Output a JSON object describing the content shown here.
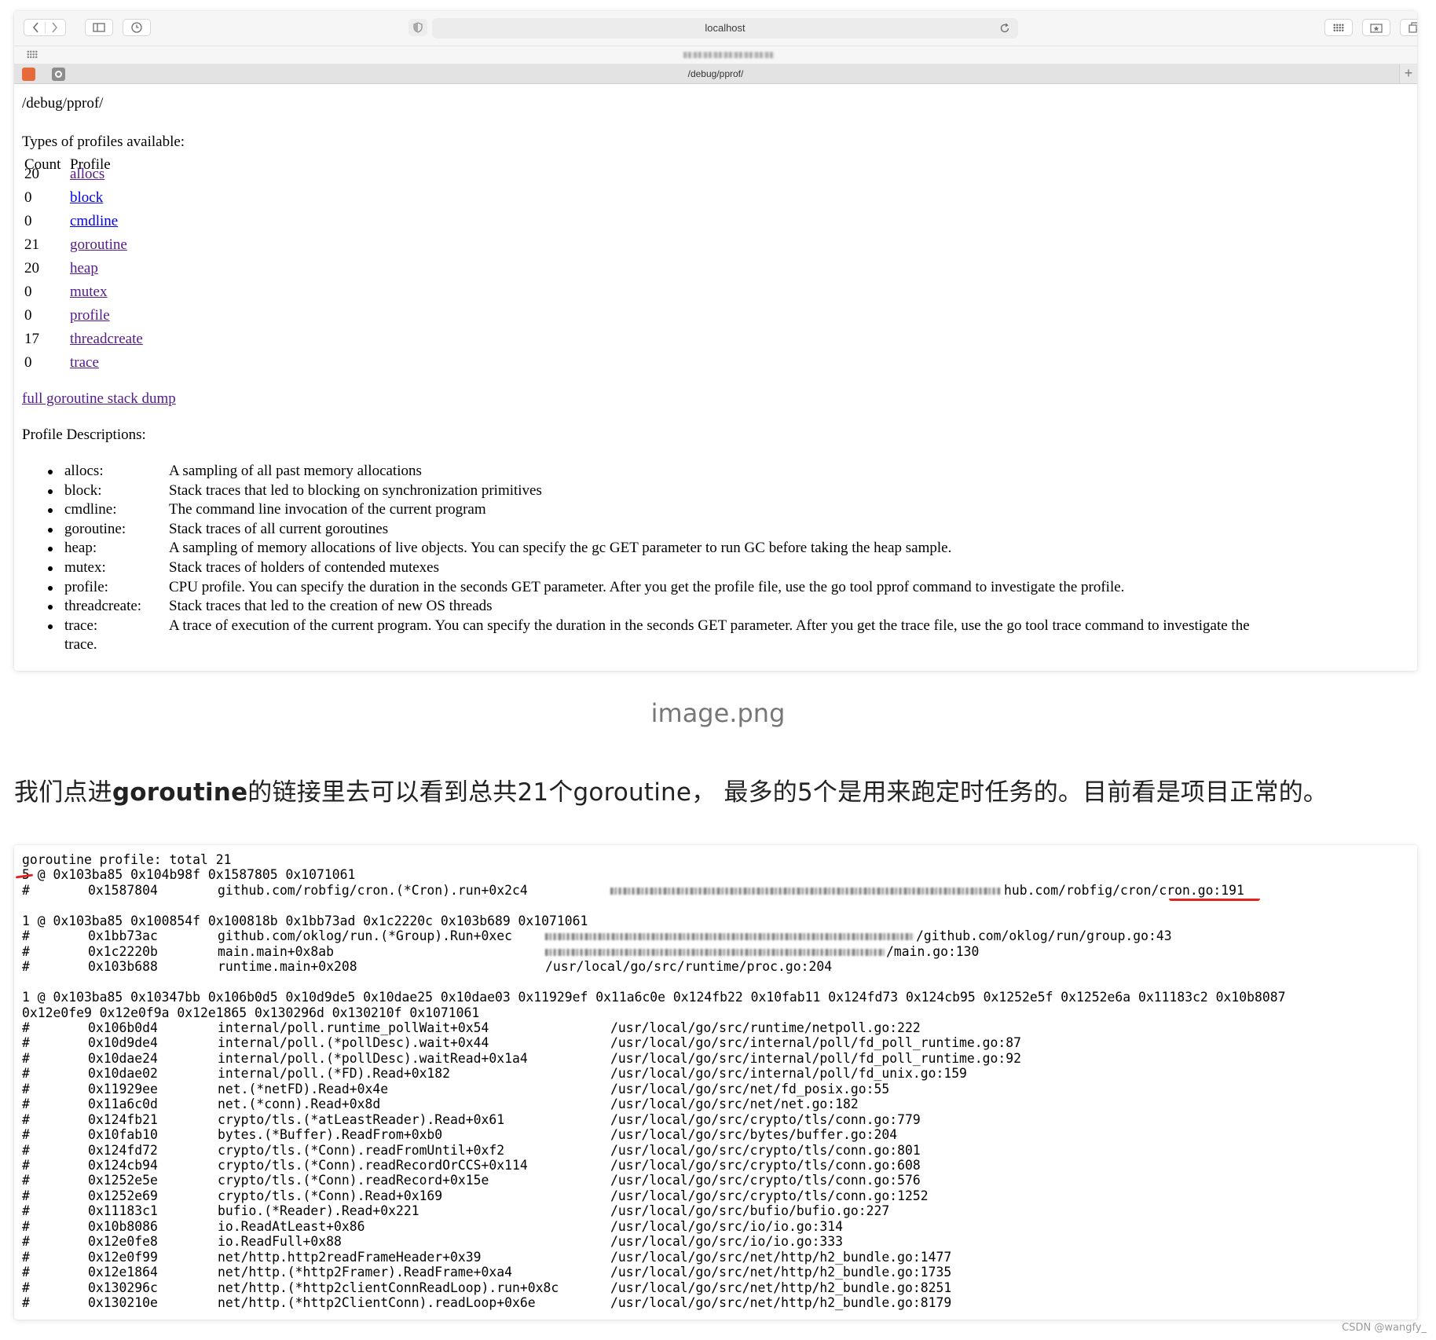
{
  "browser": {
    "address": "localhost",
    "tab_title": "/debug/pprof/",
    "tab_plus": "+"
  },
  "page": {
    "title": "/debug/pprof/",
    "types_heading": "Types of profiles available:",
    "col_count": "Count",
    "col_profile": "Profile",
    "profiles": [
      {
        "count": "20",
        "name": "allocs"
      },
      {
        "count": "0",
        "name": "block"
      },
      {
        "count": "0",
        "name": "cmdline"
      },
      {
        "count": "21",
        "name": "goroutine"
      },
      {
        "count": "20",
        "name": "heap"
      },
      {
        "count": "0",
        "name": "mutex"
      },
      {
        "count": "0",
        "name": "profile"
      },
      {
        "count": "17",
        "name": "threadcreate"
      },
      {
        "count": "0",
        "name": "trace"
      }
    ],
    "full_dump_link": "full goroutine stack dump",
    "descriptions_heading": "Profile Descriptions:",
    "descriptions": [
      {
        "term": "allocs:",
        "text": "A sampling of all past memory allocations"
      },
      {
        "term": "block:",
        "text": "Stack traces that led to blocking on synchronization primitives"
      },
      {
        "term": "cmdline:",
        "text": "The command line invocation of the current program"
      },
      {
        "term": "goroutine:",
        "text": "Stack traces of all current goroutines"
      },
      {
        "term": "heap:",
        "text": "A sampling of memory allocations of live objects. You can specify the gc GET parameter to run GC before taking the heap sample."
      },
      {
        "term": "mutex:",
        "text": "Stack traces of holders of contended mutexes"
      },
      {
        "term": "profile:",
        "text": "CPU profile. You can specify the duration in the seconds GET parameter. After you get the profile file, use the go tool pprof command to investigate the profile."
      },
      {
        "term": "threadcreate:",
        "text": "Stack traces that led to the creation of new OS threads"
      },
      {
        "term": "trace:",
        "text": "A trace of execution of the current program. You can specify the duration in the seconds GET parameter. After you get the trace file, use the go tool trace command to investigate the",
        "wrap": "trace."
      }
    ]
  },
  "caption": "image.png",
  "paragraph": {
    "before": "我们点进",
    "bold": "goroutine",
    "after": "的链接里去可以看到总共21个goroutine，  最多的5个是用来跑定时任务的。目前看是项目正常的。"
  },
  "dump": {
    "header": "goroutine profile: total 21",
    "block1": {
      "head": "5 @ 0x103ba85 0x104b98f 0x1587805 0x1071061",
      "frames": [
        {
          "addr": "0x1587804",
          "func": "github.com/robfig/cron.(*Cron).run+0x2c4",
          "file": "hub.com/robfig/cron/cron.go:191"
        }
      ]
    },
    "block2": {
      "head": "1 @ 0x103ba85 0x100854f 0x100818b 0x1bb73ad 0x1c2220c 0x103b689 0x1071061",
      "frames": [
        {
          "addr": "0x1bb73ac",
          "func": "github.com/oklog/run.(*Group).Run+0xec",
          "file": "/github.com/oklog/run/group.go:43"
        },
        {
          "addr": "0x1c2220b",
          "func": "main.main+0x8ab",
          "file": "/main.go:130"
        },
        {
          "addr": "0x103b688",
          "func": "runtime.main+0x208",
          "file": "/usr/local/go/src/runtime/proc.go:204"
        }
      ]
    },
    "block3": {
      "head": "1 @ 0x103ba85 0x10347bb 0x106b0d5 0x10d9de5 0x10dae25 0x10dae03 0x11929ef 0x11a6c0e 0x124fb22 0x10fab11 0x124fd73 0x124cb95 0x1252e5f 0x1252e6a 0x11183c2 0x10b8087",
      "head2": "0x12e0fe9 0x12e0f9a 0x12e1865 0x130296d 0x130210f 0x1071061",
      "frames": [
        {
          "addr": "0x106b0d4",
          "func": "internal/poll.runtime_pollWait+0x54",
          "file": "/usr/local/go/src/runtime/netpoll.go:222"
        },
        {
          "addr": "0x10d9de4",
          "func": "internal/poll.(*pollDesc).wait+0x44",
          "file": "/usr/local/go/src/internal/poll/fd_poll_runtime.go:87"
        },
        {
          "addr": "0x10dae24",
          "func": "internal/poll.(*pollDesc).waitRead+0x1a4",
          "file": "/usr/local/go/src/internal/poll/fd_poll_runtime.go:92"
        },
        {
          "addr": "0x10dae02",
          "func": "internal/poll.(*FD).Read+0x182",
          "file": "/usr/local/go/src/internal/poll/fd_unix.go:159"
        },
        {
          "addr": "0x11929ee",
          "func": "net.(*netFD).Read+0x4e",
          "file": "/usr/local/go/src/net/fd_posix.go:55"
        },
        {
          "addr": "0x11a6c0d",
          "func": "net.(*conn).Read+0x8d",
          "file": "/usr/local/go/src/net/net.go:182"
        },
        {
          "addr": "0x124fb21",
          "func": "crypto/tls.(*atLeastReader).Read+0x61",
          "file": "/usr/local/go/src/crypto/tls/conn.go:779"
        },
        {
          "addr": "0x10fab10",
          "func": "bytes.(*Buffer).ReadFrom+0xb0",
          "file": "/usr/local/go/src/bytes/buffer.go:204"
        },
        {
          "addr": "0x124fd72",
          "func": "crypto/tls.(*Conn).readFromUntil+0xf2",
          "file": "/usr/local/go/src/crypto/tls/conn.go:801"
        },
        {
          "addr": "0x124cb94",
          "func": "crypto/tls.(*Conn).readRecordOrCCS+0x114",
          "file": "/usr/local/go/src/crypto/tls/conn.go:608"
        },
        {
          "addr": "0x1252e5e",
          "func": "crypto/tls.(*Conn).readRecord+0x15e",
          "file": "/usr/local/go/src/crypto/tls/conn.go:576"
        },
        {
          "addr": "0x1252e69",
          "func": "crypto/tls.(*Conn).Read+0x169",
          "file": "/usr/local/go/src/crypto/tls/conn.go:1252"
        },
        {
          "addr": "0x11183c1",
          "func": "bufio.(*Reader).Read+0x221",
          "file": "/usr/local/go/src/bufio/bufio.go:227"
        },
        {
          "addr": "0x10b8086",
          "func": "io.ReadAtLeast+0x86",
          "file": "/usr/local/go/src/io/io.go:314"
        },
        {
          "addr": "0x12e0fe8",
          "func": "io.ReadFull+0x88",
          "file": "/usr/local/go/src/io/io.go:333"
        },
        {
          "addr": "0x12e0f99",
          "func": "net/http.http2readFrameHeader+0x39",
          "file": "/usr/local/go/src/net/http/h2_bundle.go:1477"
        },
        {
          "addr": "0x12e1864",
          "func": "net/http.(*http2Framer).ReadFrame+0xa4",
          "file": "/usr/local/go/src/net/http/h2_bundle.go:1735"
        },
        {
          "addr": "0x130296c",
          "func": "net/http.(*http2clientConnReadLoop).run+0x8c",
          "file": "/usr/local/go/src/net/http/h2_bundle.go:8251"
        },
        {
          "addr": "0x130210e",
          "func": "net/http.(*http2ClientConn).readLoop+0x6e",
          "file": "/usr/local/go/src/net/http/h2_bundle.go:8179"
        }
      ]
    },
    "hash": "#"
  },
  "watermark": "CSDN @wangfy_",
  "colors": {
    "link": "#0000ee",
    "visited_link": "#551a8b",
    "annotation_red": "#e1221f"
  },
  "icons": [
    "back-icon",
    "forward-icon",
    "sidebar-icon",
    "history-icon",
    "privacy-shield-icon",
    "reload-icon",
    "grid-icon",
    "share-icon",
    "tabs-icon"
  ]
}
